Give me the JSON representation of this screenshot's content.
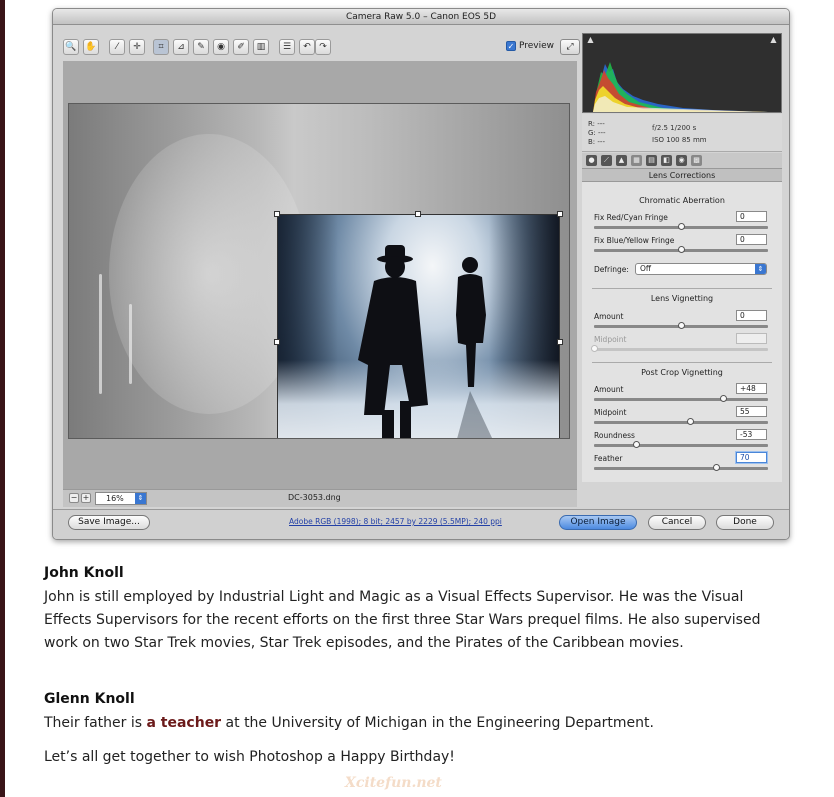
{
  "window": {
    "title": "Camera Raw 5.0  –  Canon EOS 5D",
    "toolbar": {
      "tools": [
        "zoom-icon",
        "hand-icon",
        "white-balance-icon",
        "color-sampler-icon",
        "crop-icon",
        "straighten-icon",
        "spot-removal-icon",
        "red-eye-icon",
        "adjustment-brush-icon",
        "graduated-filter-icon",
        "preferences-icon",
        "rotate-left-icon",
        "rotate-right-icon"
      ],
      "tool_glyphs": [
        "🔍",
        "✋",
        "⁄",
        "✛",
        "⌗",
        "⊿",
        "✎",
        "◉",
        "✐",
        "▥",
        "☰",
        "↶",
        "↷"
      ],
      "preview_label": "Preview",
      "preview_checked": true,
      "fullscreen_glyph": "⤢"
    },
    "canvas": {
      "zoom_minus": "−",
      "zoom_plus": "+",
      "zoom_value": "16%",
      "filename": "DC-3053.dng"
    },
    "readout": {
      "rgb": [
        "R:  ---",
        "G:  ---",
        "B:  ---"
      ],
      "camera_line1": "f/2.5    1/200 s",
      "camera_line2": "ISO 100    85 mm"
    },
    "panel": {
      "title": "Lens Corrections",
      "chromatic_aberration": {
        "title": "Chromatic Aberration",
        "fix_red_cyan": {
          "label": "Fix Red/Cyan Fringe",
          "value": "0",
          "slider": 0.5
        },
        "fix_blue_yellow": {
          "label": "Fix Blue/Yellow Fringe",
          "value": "0",
          "slider": 0.5
        },
        "defringe": {
          "label": "Defringe:",
          "value": "Off"
        }
      },
      "lens_vignetting": {
        "title": "Lens Vignetting",
        "amount": {
          "label": "Amount",
          "value": "0",
          "slider": 0.5
        },
        "midpoint": {
          "label": "Midpoint",
          "value": "",
          "slider": 0.0
        }
      },
      "post_crop_vignetting": {
        "title": "Post Crop Vignetting",
        "amount": {
          "label": "Amount",
          "value": "+48",
          "slider": 0.74
        },
        "midpoint": {
          "label": "Midpoint",
          "value": "55",
          "slider": 0.55
        },
        "roundness": {
          "label": "Roundness",
          "value": "-53",
          "slider": 0.24
        },
        "feather": {
          "label": "Feather",
          "value": "70",
          "slider": 0.7
        }
      }
    },
    "bottom": {
      "save_label": "Save Image...",
      "workflow": "Adobe RGB (1998); 8 bit; 2457 by 2229 (5.5MP); 240 ppi",
      "open_label": "Open Image",
      "cancel_label": "Cancel",
      "done_label": "Done"
    }
  },
  "article": {
    "person1_name": "John Knoll",
    "person1_bio": "John is still employed by Industrial Light and Magic as a Visual Effects Supervisor. He was the Visual Effects Supervisors for the recent efforts on the first three Star Wars prequel films. He also supervised work on two Star Trek movies, Star Trek episodes, and the Pirates of the Caribbean movies.",
    "person2_name": "Glenn Knoll",
    "person2_pre": "Their father is ",
    "person2_link": "a teacher",
    "person2_post": " at the University of Michigan in the Engineering Department.",
    "closing": "Let’s all get together to wish Photoshop a Happy Birthday!",
    "watermark": "Xcitefun.net"
  },
  "colors": {
    "accent_blue": "#3a77d1",
    "link_color": "#6b1a1a",
    "left_bar": "#3a1418"
  }
}
